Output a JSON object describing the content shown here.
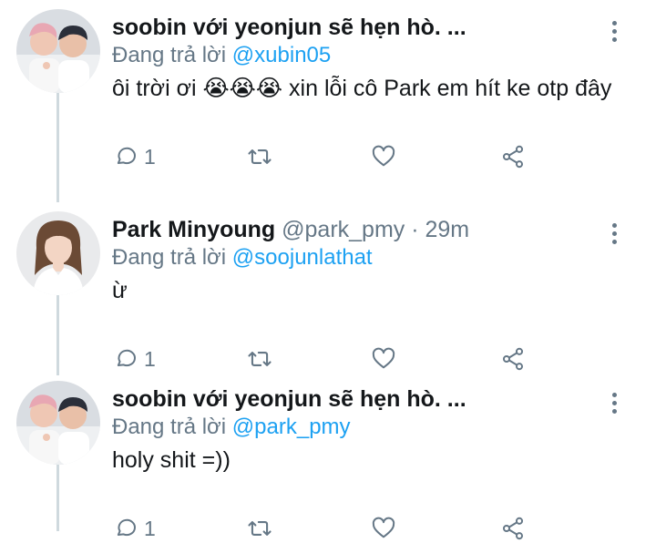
{
  "tweets": [
    {
      "name": "soobin với yeonjun sẽ hẹn hò. ...",
      "handle_meta": "",
      "replying_prefix": "Đang trả lời",
      "replying_to": "@xubin05",
      "text": "ôi trời ơi 😭😭😭 xin lỗi cô Park em hít ke otp đây",
      "reply_count": "1",
      "avatar": "two-people-avatar"
    },
    {
      "name": "Park Minyoung",
      "handle_meta": "@park_pmy · 29m",
      "replying_prefix": "Đang trả lời",
      "replying_to": "@soojunlathat",
      "text": "ừ",
      "reply_count": "1",
      "avatar": "woman-avatar"
    },
    {
      "name": "soobin với yeonjun sẽ hẹn hò. ...",
      "handle_meta": "",
      "replying_prefix": "Đang trả lời",
      "replying_to": "@park_pmy",
      "text": "holy shit =))",
      "reply_count": "1",
      "avatar": "two-people-avatar"
    }
  ],
  "icons": {
    "reply": "reply-icon",
    "retweet": "retweet-icon",
    "like": "like-icon",
    "share": "share-icon",
    "more": "more-vertical-icon"
  },
  "colors": {
    "mention": "#1da1f2",
    "secondary": "#657786",
    "text": "#14171a",
    "thread_line": "#cfd9de"
  }
}
